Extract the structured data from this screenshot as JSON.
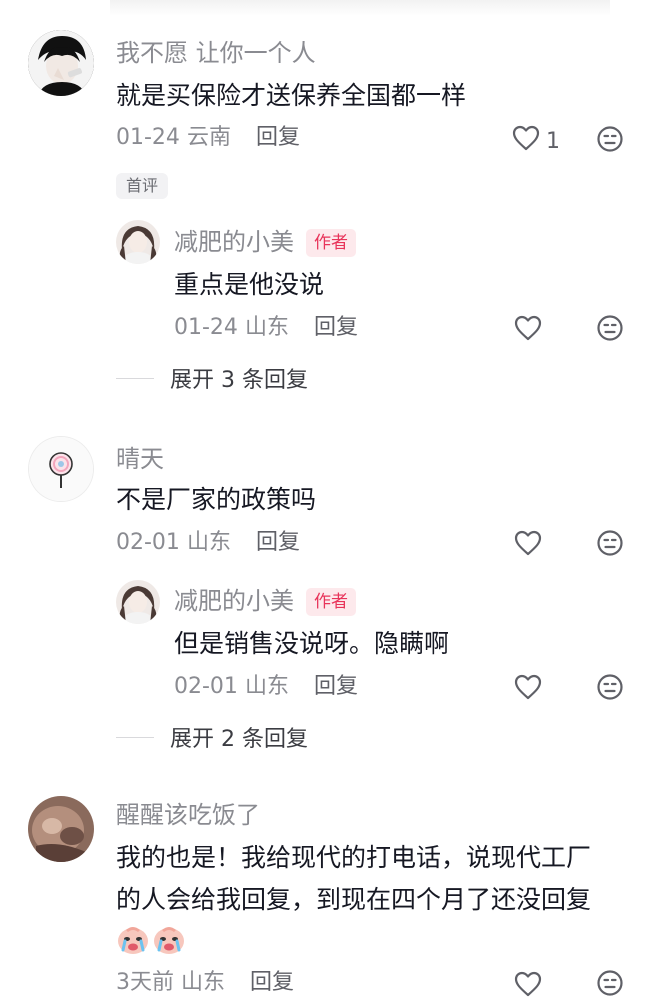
{
  "comments": [
    {
      "username": "我不愿 让你一个人",
      "content": "就是买保险才送保养全国都一样",
      "date": "01-24",
      "location": "云南",
      "reply_label": "回复",
      "like_count": "1",
      "first_badge": "首评",
      "reply": {
        "username": "减肥的小美",
        "author_badge": "作者",
        "content": "重点是他没说",
        "date": "01-24",
        "location": "山东",
        "reply_label": "回复"
      },
      "expand_label": "展开 3 条回复"
    },
    {
      "username": "晴天",
      "content": "不是厂家的政策吗",
      "date": "02-01",
      "location": "山东",
      "reply_label": "回复",
      "reply": {
        "username": "减肥的小美",
        "author_badge": "作者",
        "content": "但是销售没说呀。隐瞒啊",
        "date": "02-01",
        "location": "山东",
        "reply_label": "回复"
      },
      "expand_label": "展开 2 条回复"
    },
    {
      "username": "醒醒该吃饭了",
      "content_lines": [
        "我的也是！我给现代的打电话，说现代工厂",
        "的人会给我回复，到现在四个月了还没回复"
      ],
      "emojis": [
        "crying-emoji",
        "crying-emoji"
      ],
      "date": "3天前",
      "location": "山东",
      "reply_label": "回复"
    }
  ],
  "icons": {
    "like": "heart-outline-icon",
    "dislike": "neutral-face-icon"
  },
  "colors": {
    "author_badge_bg": "#fde9ec",
    "author_badge_text": "#e8345a",
    "meta_text": "#8a8b91"
  }
}
